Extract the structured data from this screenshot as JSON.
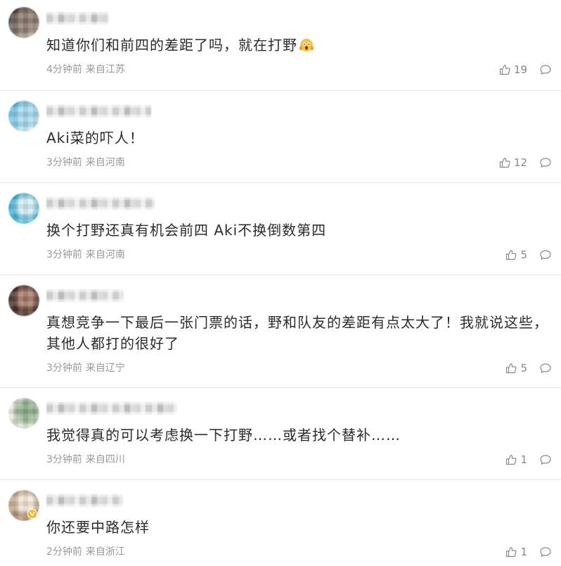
{
  "comments": [
    {
      "text": "知道你们和前四的差距了吗，就在打野",
      "emoji_icon": "scream-emoji-icon",
      "time": "4分钟前",
      "location": "来自江苏",
      "likes": 19,
      "avatar_colors": [
        "#2c2623",
        "#8c7b6d",
        "#d6c7b8"
      ]
    },
    {
      "text": "Aki菜的吓人！",
      "time": "3分钟前",
      "location": "来自河南",
      "likes": 12,
      "avatar_colors": [
        "#3fb0dc",
        "#a6dcf1",
        "#eef8fc"
      ]
    },
    {
      "text": "换个打野还真有机会前四 Aki不换倒数第四",
      "time": "3分钟前",
      "location": "来自河南",
      "likes": 5,
      "avatar_colors": [
        "#23a9d2",
        "#d4f0f8",
        "#7ccde6"
      ]
    },
    {
      "text": "真想竞争一下最后一张门票的话，野和队友的差距有点太大了！我就说这些，其他人都打的很好了",
      "time": "3分钟前",
      "location": "来自辽宁",
      "likes": 5,
      "avatar_colors": [
        "#3a2622",
        "#a87a6a",
        "#5b3b33"
      ]
    },
    {
      "text": "我觉得真的可以考虑换一下打野……或者找个替补……",
      "time": "3分钟前",
      "location": "来自四川",
      "likes": 1,
      "avatar_colors": [
        "#eef2ea",
        "#8fae8a",
        "#cfdcc6"
      ]
    },
    {
      "text": "你还要中路怎样",
      "time": "2分钟前",
      "location": "来自浙江",
      "likes": 1,
      "avatar_colors": [
        "#c9ad90",
        "#f3e7d8",
        "#a88a6e"
      ],
      "avatar_badge": "verified-badge-icon"
    }
  ],
  "icons": {
    "like": "thumbs-up-icon",
    "reply": "comment-bubble-icon"
  },
  "colors": {
    "background": "#ffffff",
    "text": "#2b2b2b",
    "meta": "#999999",
    "icon": "#888888",
    "divider": "#e8e8e8",
    "verified_badge": "#f5b81d"
  }
}
